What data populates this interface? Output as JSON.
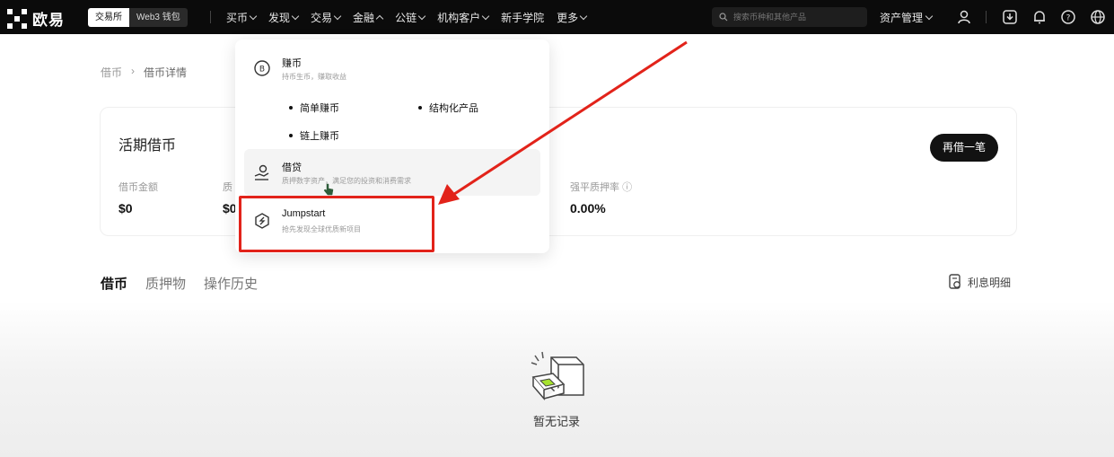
{
  "header": {
    "logo_text": "欧易",
    "segment": [
      "交易所",
      "Web3 钱包"
    ],
    "nav": [
      {
        "label": "买币",
        "chevron": "down"
      },
      {
        "label": "发现",
        "chevron": "down"
      },
      {
        "label": "交易",
        "chevron": "down"
      },
      {
        "label": "金融",
        "chevron": "up"
      },
      {
        "label": "公链",
        "chevron": "down"
      },
      {
        "label": "机构客户",
        "chevron": "down"
      },
      {
        "label": "新手学院",
        "chevron": ""
      },
      {
        "label": "更多",
        "chevron": "down"
      }
    ],
    "search_placeholder": "搜索币种和其他产品",
    "asset_label": "资产管理",
    "icons": [
      "user-icon",
      "download-icon",
      "bell-icon",
      "help-icon",
      "globe-icon"
    ]
  },
  "breadcrumb": {
    "items": [
      "借币",
      "借币详情"
    ]
  },
  "card": {
    "title": "活期借币",
    "stats": [
      {
        "label": "借币金额",
        "value": "$0"
      },
      {
        "label": "质",
        "value": "$0"
      },
      {
        "label": "强平质押率",
        "value": "0.00%"
      }
    ],
    "button": "再借一笔"
  },
  "tabs": [
    "借币",
    "质押物",
    "操作历史"
  ],
  "interest_link": "利息明细",
  "empty_text": "暂无记录",
  "dropdown": {
    "earn": {
      "title": "赚币",
      "desc": "持币生币，赚取收益",
      "items": [
        "简单赚币",
        "结构化产品",
        "链上赚币"
      ]
    },
    "loan": {
      "title": "借贷",
      "desc": "质押数字资产，满足您的投资和消费需求"
    },
    "jumpstart": {
      "title": "Jumpstart",
      "desc": "抢先发现全球优质新项目"
    }
  },
  "colors": {
    "topbar": "#0b0b0b",
    "annotation": "#e2231a",
    "button": "#121212"
  }
}
